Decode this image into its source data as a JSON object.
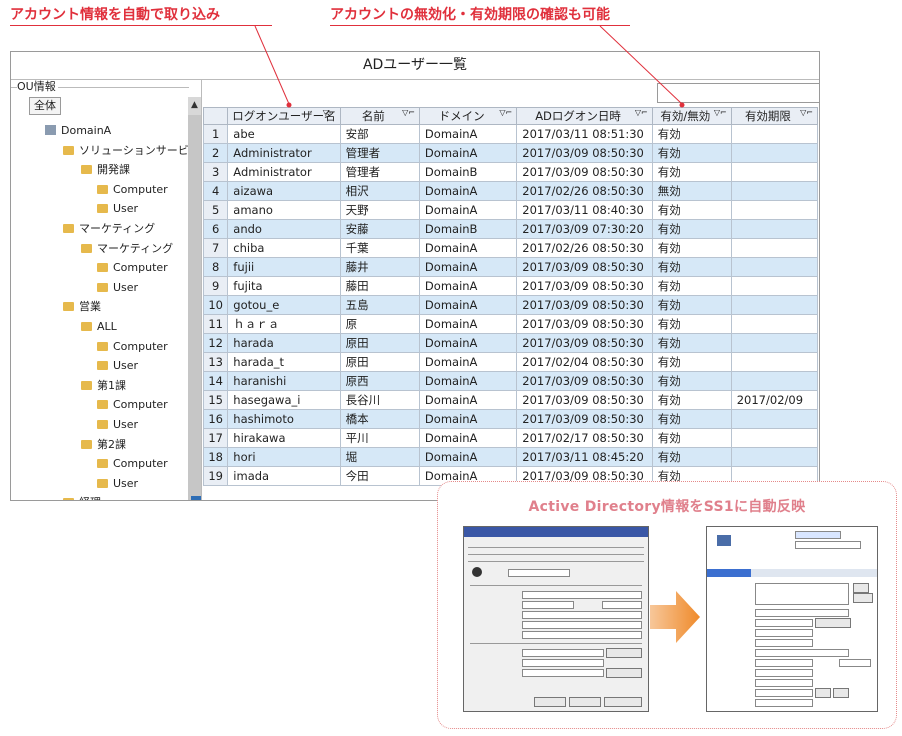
{
  "callouts": {
    "import": "アカウント情報を自動で取り込み",
    "validity": "アカウントの無効化・有効期限の確認も可能"
  },
  "window": {
    "title": "ADユーザー一覧"
  },
  "ou_panel": {
    "label": "OU情報",
    "all_button": "全体",
    "tree": [
      {
        "label": "DomainA",
        "level": 0,
        "icon": "domain-icon"
      },
      {
        "label": "ソリューションサービス",
        "level": 1,
        "icon": "folder-icon"
      },
      {
        "label": "開発課",
        "level": 2,
        "icon": "folder-icon"
      },
      {
        "label": "Computer",
        "level": 3,
        "icon": "folder-icon"
      },
      {
        "label": "User",
        "level": 3,
        "icon": "folder-icon"
      },
      {
        "label": "マーケティング",
        "level": 1,
        "icon": "folder-icon"
      },
      {
        "label": "マーケティング",
        "level": 2,
        "icon": "folder-icon"
      },
      {
        "label": "Computer",
        "level": 3,
        "icon": "folder-icon"
      },
      {
        "label": "User",
        "level": 3,
        "icon": "folder-icon"
      },
      {
        "label": "営業",
        "level": 1,
        "icon": "folder-icon"
      },
      {
        "label": "ALL",
        "level": 2,
        "icon": "folder-icon"
      },
      {
        "label": "Computer",
        "level": 3,
        "icon": "folder-icon"
      },
      {
        "label": "User",
        "level": 3,
        "icon": "folder-icon"
      },
      {
        "label": "第1課",
        "level": 2,
        "icon": "folder-icon"
      },
      {
        "label": "Computer",
        "level": 3,
        "icon": "folder-icon"
      },
      {
        "label": "User",
        "level": 3,
        "icon": "folder-icon"
      },
      {
        "label": "第2課",
        "level": 2,
        "icon": "folder-icon"
      },
      {
        "label": "Computer",
        "level": 3,
        "icon": "folder-icon"
      },
      {
        "label": "User",
        "level": 3,
        "icon": "folder-icon"
      },
      {
        "label": "経理",
        "level": 1,
        "icon": "folder-icon"
      }
    ]
  },
  "grid": {
    "columns": [
      "ログオンユーザー名",
      "名前",
      "ドメイン",
      "ADログオン日時",
      "有効/無効",
      "有効期限"
    ],
    "rows": [
      [
        "1",
        "abe",
        "安部",
        "DomainA",
        "2017/03/11 08:51:30",
        "有効",
        ""
      ],
      [
        "2",
        "Administrator",
        "管理者",
        "DomainA",
        "2017/03/09 08:50:30",
        "有効",
        ""
      ],
      [
        "3",
        "Administrator",
        "管理者",
        "DomainB",
        "2017/03/09 08:50:30",
        "有効",
        ""
      ],
      [
        "4",
        "aizawa",
        "相沢",
        "DomainA",
        "2017/02/26 08:50:30",
        "無効",
        ""
      ],
      [
        "5",
        "amano",
        "天野",
        "DomainA",
        "2017/03/11 08:40:30",
        "有効",
        ""
      ],
      [
        "6",
        "ando",
        "安藤",
        "DomainB",
        "2017/03/09 07:30:20",
        "有効",
        ""
      ],
      [
        "7",
        "chiba",
        "千葉",
        "DomainA",
        "2017/02/26 08:50:30",
        "有効",
        ""
      ],
      [
        "8",
        "fujii",
        "藤井",
        "DomainA",
        "2017/03/09 08:50:30",
        "有効",
        ""
      ],
      [
        "9",
        "fujita",
        "藤田",
        "DomainA",
        "2017/03/09 08:50:30",
        "有効",
        ""
      ],
      [
        "10",
        "gotou_e",
        "五島",
        "DomainA",
        "2017/03/09 08:50:30",
        "有効",
        ""
      ],
      [
        "11",
        "ｈａｒａ",
        "原",
        "DomainA",
        "2017/03/09 08:50:30",
        "有効",
        ""
      ],
      [
        "12",
        "harada",
        "原田",
        "DomainA",
        "2017/03/09 08:50:30",
        "有効",
        ""
      ],
      [
        "13",
        "harada_t",
        "原田",
        "DomainA",
        "2017/02/04 08:50:30",
        "有効",
        ""
      ],
      [
        "14",
        "haranishi",
        "原西",
        "DomainA",
        "2017/03/09 08:50:30",
        "有効",
        ""
      ],
      [
        "15",
        "hasegawa_i",
        "長谷川",
        "DomainA",
        "2017/03/09 08:50:30",
        "有効",
        "2017/02/09"
      ],
      [
        "16",
        "hashimoto",
        "橋本",
        "DomainA",
        "2017/03/09 08:50:30",
        "有効",
        ""
      ],
      [
        "17",
        "hirakawa",
        "平川",
        "DomainA",
        "2017/02/17 08:50:30",
        "有効",
        ""
      ],
      [
        "18",
        "hori",
        "堀",
        "DomainA",
        "2017/03/11 08:45:20",
        "有効",
        ""
      ],
      [
        "19",
        "imada",
        "今田",
        "DomainA",
        "2017/03/09 08:50:30",
        "有効",
        ""
      ]
    ]
  },
  "ad_panel": {
    "title": "Active Directory情報をSS1に自動反映"
  },
  "colors": {
    "accent_red": "#e0303c",
    "row_alt": "#d6e8f7",
    "header": "#e9eef5"
  }
}
